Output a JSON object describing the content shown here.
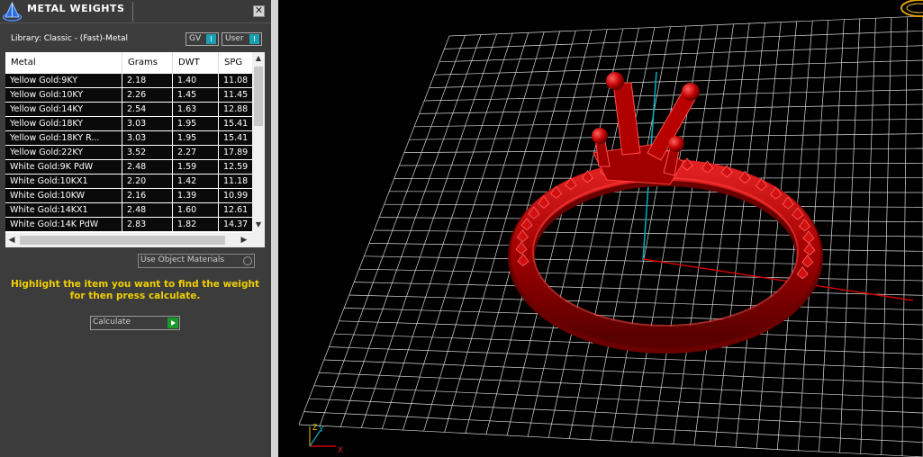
{
  "panel": {
    "title": "METAL WEIGHTS",
    "close_glyph": "✕",
    "library_label": "Library: Classic - (Fast)-Metal",
    "toggles": [
      {
        "label": "GV",
        "knob": "I"
      },
      {
        "label": "User",
        "knob": "I"
      }
    ],
    "table": {
      "columns": [
        "Metal",
        "Grams",
        "DWT",
        "SPG"
      ],
      "rows": [
        [
          "Yellow Gold:9KY",
          "2.18",
          "1.40",
          "11.08"
        ],
        [
          "Yellow Gold:10KY",
          "2.26",
          "1.45",
          "11.45"
        ],
        [
          "Yellow Gold:14KY",
          "2.54",
          "1.63",
          "12.88"
        ],
        [
          "Yellow Gold:18KY",
          "3.03",
          "1.95",
          "15.41"
        ],
        [
          "Yellow Gold:18KY R...",
          "3.03",
          "1.95",
          "15.41"
        ],
        [
          "Yellow Gold:22KY",
          "3.52",
          "2.27",
          "17.89"
        ],
        [
          "White Gold:9K PdW",
          "2.48",
          "1.59",
          "12.59"
        ],
        [
          "White Gold:10KX1",
          "2.20",
          "1.42",
          "11.18"
        ],
        [
          "White Gold:10KW",
          "2.16",
          "1.39",
          "10.99"
        ],
        [
          "White Gold:14KX1",
          "2.48",
          "1.60",
          "12.61"
        ],
        [
          "White Gold:14K PdW",
          "2.83",
          "1.82",
          "14.37"
        ]
      ]
    },
    "use_object_materials": "Use Object Materials",
    "instructions": "Highlight the item you want to find the weight for then press calculate.",
    "calculate_label": "Calculate"
  },
  "viewport": {
    "axis_labels": {
      "x": "X",
      "y": "Y",
      "z": "Z"
    }
  },
  "colors": {
    "panel_bg": "#3c3c3c",
    "instruction_text": "#f0d000",
    "toggle_knob": "#1aa0b4",
    "calculate_arrow": "#1a9a2a",
    "ring_red": "#b00000",
    "grid_line": "#d0d0d0",
    "x_axis": "#d00000",
    "y_axis": "#00b0c0"
  },
  "icons": {
    "app_logo": "pyramid-logo-icon",
    "close": "close-icon",
    "calculate_arrow": "play-arrow-icon",
    "scroll_up": "chevron-up-icon",
    "scroll_down": "chevron-down-icon",
    "scroll_left": "chevron-left-icon",
    "scroll_right": "chevron-right-icon",
    "view_cube": "view-ring-icon"
  }
}
